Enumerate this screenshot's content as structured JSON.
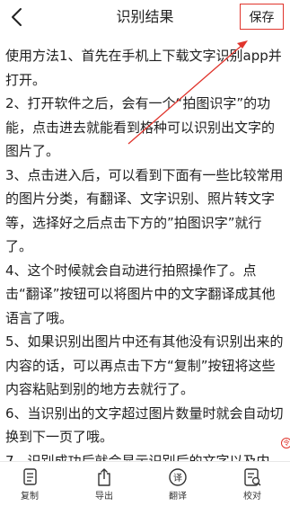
{
  "header": {
    "title": "识别结果",
    "save_label": "保存"
  },
  "content": {
    "paragraphs": [
      "使用方法1、首先在手机上下载文字识别app并打开。",
      "2、打开软件之后，会有一个“拍图识字”的功能，点击进去就能看到格种可以识别出文字的图片了。",
      "3、点击进入后，可以看到下面有一些比较常用的图片分类，有翻译、文字识别、照片转文字等，选择好之后点击下方的”拍图识字”就行了。",
      "4、这个时候就会自动进行拍照操作了。点击“翻译”按钮可以将图片中的文字翻译成其他语言了哦。",
      "5、如果识别出图片中还有其他没有识别出来的内容的话，可以再点击下方“复制”按钮将这些内容粘贴到别的地方去就行了。",
      "6、当识别出的文字超过图片数量时就会自动切换到下一页了哦。",
      "7、识别成功后就会显示识别后的文字以及内"
    ],
    "edge_glyph": "令"
  },
  "toolbar": {
    "items": [
      {
        "label": "复制",
        "icon": "copy-icon"
      },
      {
        "label": "导出",
        "icon": "export-icon"
      },
      {
        "label": "翻译",
        "icon": "translate-icon"
      },
      {
        "label": "校对",
        "icon": "proofread-icon"
      }
    ],
    "translate_glyph": "译"
  },
  "colors": {
    "accent_red": "#e0342c",
    "text": "#1f1f1f"
  }
}
